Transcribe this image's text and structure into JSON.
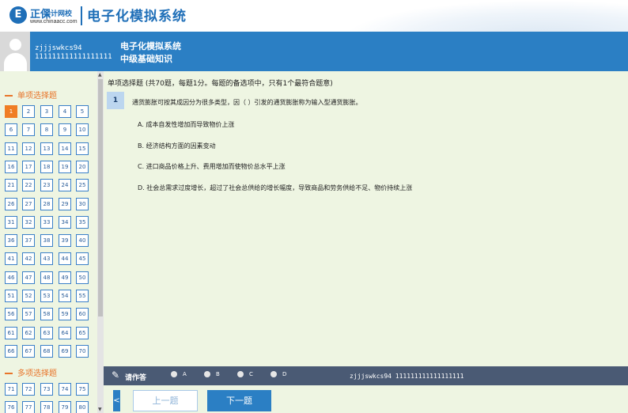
{
  "brand": {
    "logo_glyph": "E",
    "name": "正保",
    "sub": "会计网校",
    "url": "www.chinaacc.com",
    "system_title": "电子化模拟系统"
  },
  "user": {
    "username": "zjjjswkcs94",
    "id": "111111111111111111"
  },
  "exam": {
    "system": "电子化模拟系统",
    "subject": "中级基础知识"
  },
  "sidebar": {
    "sections": [
      {
        "label": "单项选择题",
        "start": 1,
        "end": 70
      },
      {
        "label": "多项选择题",
        "start": 71,
        "end": 80
      }
    ],
    "current": 1
  },
  "question": {
    "type_header": "单项选择题 (共70题，每题1分。每题的备选项中，只有1个最符合题意)",
    "number": "1",
    "stem": "通货膨胀可按其成因分为很多类型，因（    ）引发的通货膨胀称为输入型通货膨胀。",
    "options": [
      "A. 成本自发性增加而导致物价上涨",
      "B. 经济结构方面的因素变动",
      "C. 进口商品价格上升、费用增加而使物价总水平上涨",
      "D. 社会总需求过度增长，超过了社会总供给的增长幅度，导致商品和劳务供给不足、物价持续上涨"
    ]
  },
  "answer_bar": {
    "label": "请作答",
    "choices": [
      "A",
      "B",
      "C",
      "D"
    ],
    "user_text": "zjjjswkcs94 111111111111111111",
    "icon": "pen-icon"
  },
  "nav": {
    "collapse": "<",
    "prev": "上一题",
    "next": "下一题"
  },
  "colors": {
    "primary_blue": "#2b7fc4",
    "panel_green": "#eef5e2",
    "current_orange": "#f07d24",
    "answer_bar": "#4a5a74"
  }
}
